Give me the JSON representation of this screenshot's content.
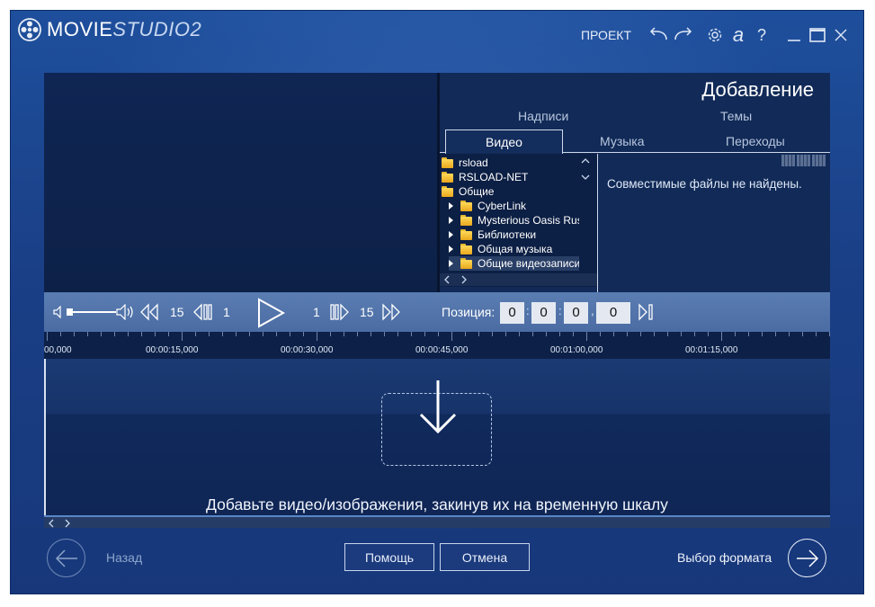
{
  "app": {
    "logo_movie": "MOVIE",
    "logo_studio": "STUDIO2",
    "project_label": "ПРОЕКТ",
    "help_glyph": "?",
    "account_glyph": "a"
  },
  "panel": {
    "title": "Добавление",
    "tabs_top": [
      "Надписи",
      "Темы"
    ],
    "tabs_bottom": [
      "Видео",
      "Музыка",
      "Переходы"
    ],
    "active_tab": "Видео",
    "tree": [
      {
        "label": "rsload",
        "level": 0
      },
      {
        "label": "RSLOAD-NET",
        "level": 0
      },
      {
        "label": "Общие",
        "level": 0
      },
      {
        "label": "CyberLink",
        "level": 1
      },
      {
        "label": "Mysterious Oasis Rus",
        "level": 1
      },
      {
        "label": "Библиотеки",
        "level": 1
      },
      {
        "label": "Общая музыка",
        "level": 1
      },
      {
        "label": "Общие видеозаписи",
        "level": 1,
        "selected": true
      }
    ],
    "empty_message": "Совместимые файлы не найдены."
  },
  "transport": {
    "skip_back_big": "15",
    "skip_back_small": "1",
    "skip_fwd_small": "1",
    "skip_fwd_big": "15",
    "position_label": "Позиция:",
    "position_values": [
      "0",
      "0",
      "0",
      "0"
    ],
    "volume_level": 0.05
  },
  "ruler": {
    "labels": [
      "00,000",
      "00:00:15,000",
      "00:00:30,000",
      "00:00:45,000",
      "00:01:00,000",
      "00:01:15,000"
    ]
  },
  "timeline": {
    "drop_hint": "Добавьте видео/изображения, закинув их на временную шкалу"
  },
  "footer": {
    "back_label": "Назад",
    "help_label": "Помощь",
    "cancel_label": "Отмена",
    "next_label": "Выбор формата"
  }
}
